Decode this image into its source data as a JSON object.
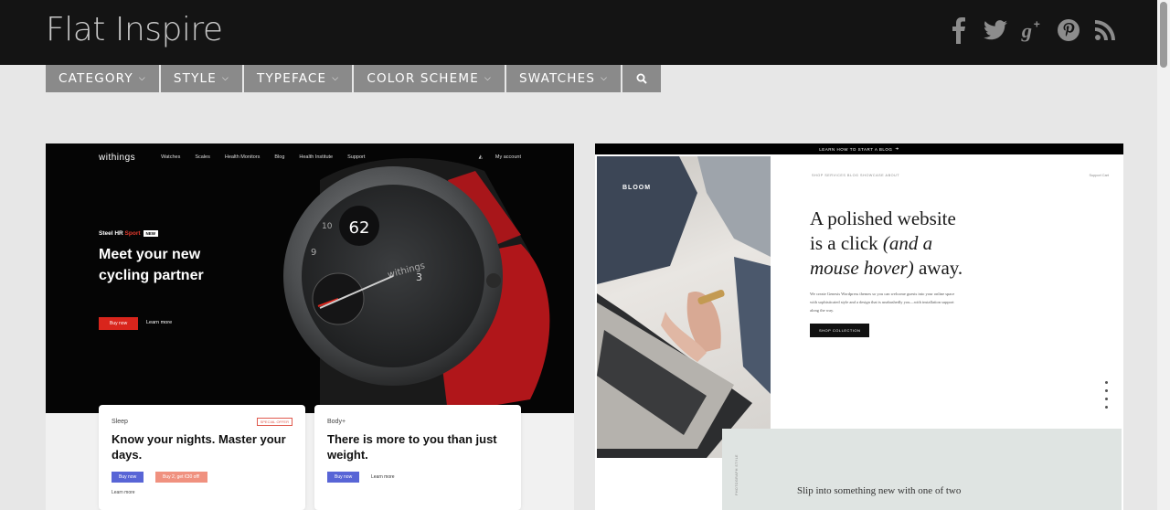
{
  "header": {
    "site_title": "Flat Inspire",
    "social": [
      {
        "name": "facebook-icon",
        "glyph": "f"
      },
      {
        "name": "twitter-icon",
        "glyph": "t"
      },
      {
        "name": "google-plus-icon",
        "glyph": "g+"
      },
      {
        "name": "pinterest-icon",
        "glyph": "p"
      },
      {
        "name": "rss-icon",
        "glyph": "rss"
      }
    ]
  },
  "nav": {
    "items": [
      {
        "label": "CATEGORY"
      },
      {
        "label": "STYLE"
      },
      {
        "label": "TYPEFACE"
      },
      {
        "label": "COLOR SCHEME"
      },
      {
        "label": "SWATCHES"
      }
    ],
    "search_icon": "search-icon"
  },
  "cards": {
    "withings": {
      "logo": "withings",
      "nav_links": [
        "Watches",
        "Scales",
        "Health Monitors",
        "Blog",
        "Health Institute",
        "Support"
      ],
      "account": "My account",
      "tag_prefix": "Steel HR ",
      "tag_sport": "Sport",
      "tag_new": "NEW",
      "headline": "Meet your new cycling partner",
      "buy": "Buy now",
      "learn": "Learn more",
      "watch_time": "62",
      "watch_brand": "withings",
      "box1": {
        "sub": "Sleep",
        "offer": "SPECIAL OFFER",
        "title": "Know your nights. Master your days.",
        "btn1": "Buy now",
        "btn2": "Buy 2, get €30 off!",
        "learn": "Learn more"
      },
      "box2": {
        "sub": "Body+",
        "title": "There is more to you than just weight.",
        "btn1": "Buy now",
        "learn": "Learn more"
      }
    },
    "bloom": {
      "strip": "LEARN HOW TO START A BLOG",
      "brand": "BLOOM",
      "menu": "SHOP   SERVICES   BLOG   SHOWCASE   ABOUT",
      "menu_right": "Support   Cart",
      "h1_line1": "A polished website",
      "h1_line2_a": "is a click ",
      "h1_line2_b": "(and a",
      "h1_line3_a": "mouse hover)",
      "h1_line3_b": " away.",
      "para": "We create Genesis Wordpress themes so you can welcome guests into your online space with sophisticated style and a design that is unabashedly you—with installation support along the way.",
      "shop": "SHOP COLLECTION",
      "vert": "PHOTOGRAPH STYLE",
      "slip": "Slip into something new with one of two"
    }
  }
}
